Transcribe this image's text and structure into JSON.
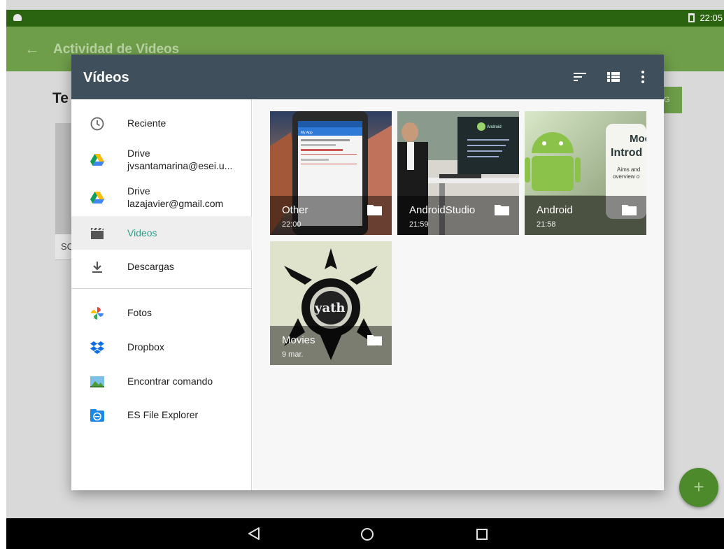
{
  "status_bar": {
    "time": "22:05"
  },
  "app_bar": {
    "title": "Actividad de Videos"
  },
  "underlying": {
    "heading": "Te",
    "card_label": "SC",
    "chip_label": "G"
  },
  "dialog": {
    "title": "Vídeos",
    "drawer": {
      "recent": "Reciente",
      "drive1_title": "Drive",
      "drive1_account": "jvsantamarina@esei.u...",
      "drive2_title": "Drive",
      "drive2_account": "lazajavier@gmail.com",
      "videos": "Videos",
      "downloads": "Descargas",
      "photos": "Fotos",
      "dropbox": "Dropbox",
      "find_command": "Encontrar comando",
      "es_explorer": "ES File Explorer"
    },
    "folders": [
      {
        "name": "Other",
        "date": "22:00"
      },
      {
        "name": "AndroidStudio",
        "date": "21:59"
      },
      {
        "name": "Android",
        "date": "21:58"
      },
      {
        "name": "Movies",
        "date": "9 mar."
      }
    ],
    "thumb_text": {
      "my_app": "My App",
      "android_studio_logo": "Android",
      "intro_1": "Moc",
      "intro_2": "Introd",
      "intro_3": "Aims and",
      "intro_4": "overview o",
      "movie_title": "yath"
    }
  },
  "fab": {
    "label": "+"
  },
  "colors": {
    "status_bar": "#2b6410",
    "app_bar": "#6f9e4a",
    "dialog_toolbar": "#3f505c",
    "selected_text": "#2f9c89"
  }
}
